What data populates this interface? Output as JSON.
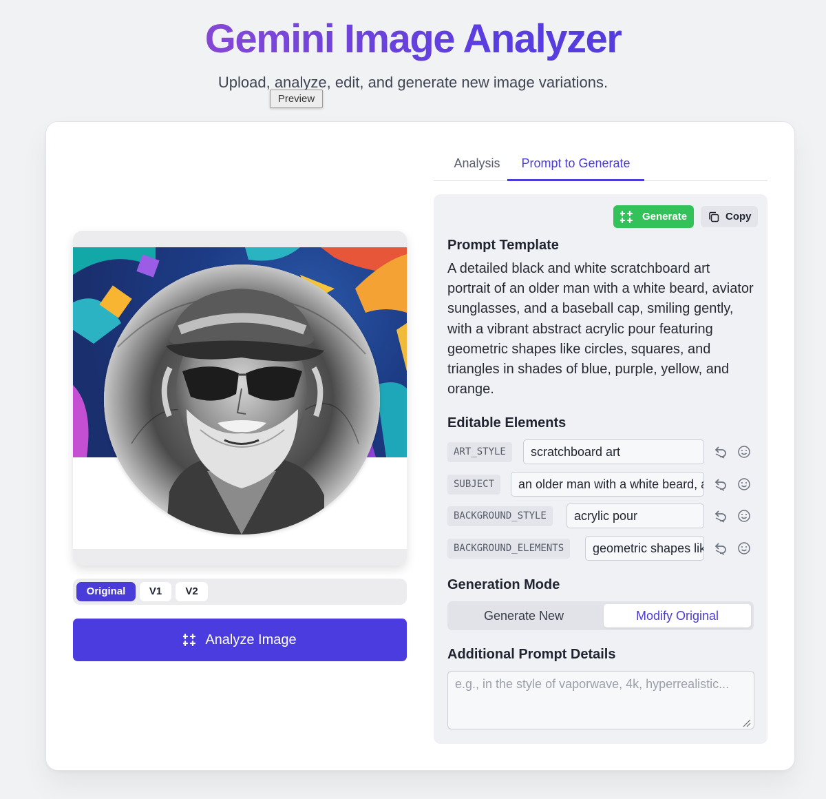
{
  "header": {
    "title": "Gemini Image Analyzer",
    "subtitle": "Upload, analyze, edit, and generate new image variations.",
    "tooltip": "Preview"
  },
  "versions": [
    {
      "label": "Original",
      "active": true
    },
    {
      "label": "V1",
      "active": false
    },
    {
      "label": "V2",
      "active": false
    }
  ],
  "analyze_button": "Analyze Image",
  "tabs": [
    {
      "label": "Analysis",
      "active": false
    },
    {
      "label": "Prompt to Generate",
      "active": true
    }
  ],
  "actions": {
    "generate": "Generate",
    "copy": "Copy"
  },
  "prompt_template": {
    "heading": "Prompt Template",
    "text": "A detailed black and white scratchboard art portrait of an older man with a white beard, aviator sunglasses, and a baseball cap, smiling gently, with a vibrant abstract acrylic pour featuring geometric shapes like circles, squares, and triangles in shades of blue, purple, yellow, and orange."
  },
  "editable_elements": {
    "heading": "Editable Elements",
    "items": [
      {
        "key": "ART_STYLE",
        "value": "scratchboard art"
      },
      {
        "key": "SUBJECT",
        "value": "an older man with a white beard, aviator sunglasses, and a baseball cap, smiling gently"
      },
      {
        "key": "BACKGROUND_STYLE",
        "value": "acrylic pour"
      },
      {
        "key": "BACKGROUND_ELEMENTS",
        "value": "geometric shapes like circles, squares, and triangles"
      }
    ]
  },
  "generation_mode": {
    "heading": "Generation Mode",
    "options": [
      {
        "label": "Generate New",
        "active": false
      },
      {
        "label": "Modify Original",
        "active": true
      }
    ]
  },
  "additional_details": {
    "heading": "Additional Prompt Details",
    "placeholder": "e.g., in the style of vaporwave, 4k, hyperrealistic...",
    "value": ""
  },
  "colors": {
    "accent": "#4a3cd8",
    "generate_green": "#33c15a",
    "title_gradient_start": "#a846b6",
    "title_gradient_end": "#4b3ad8"
  }
}
